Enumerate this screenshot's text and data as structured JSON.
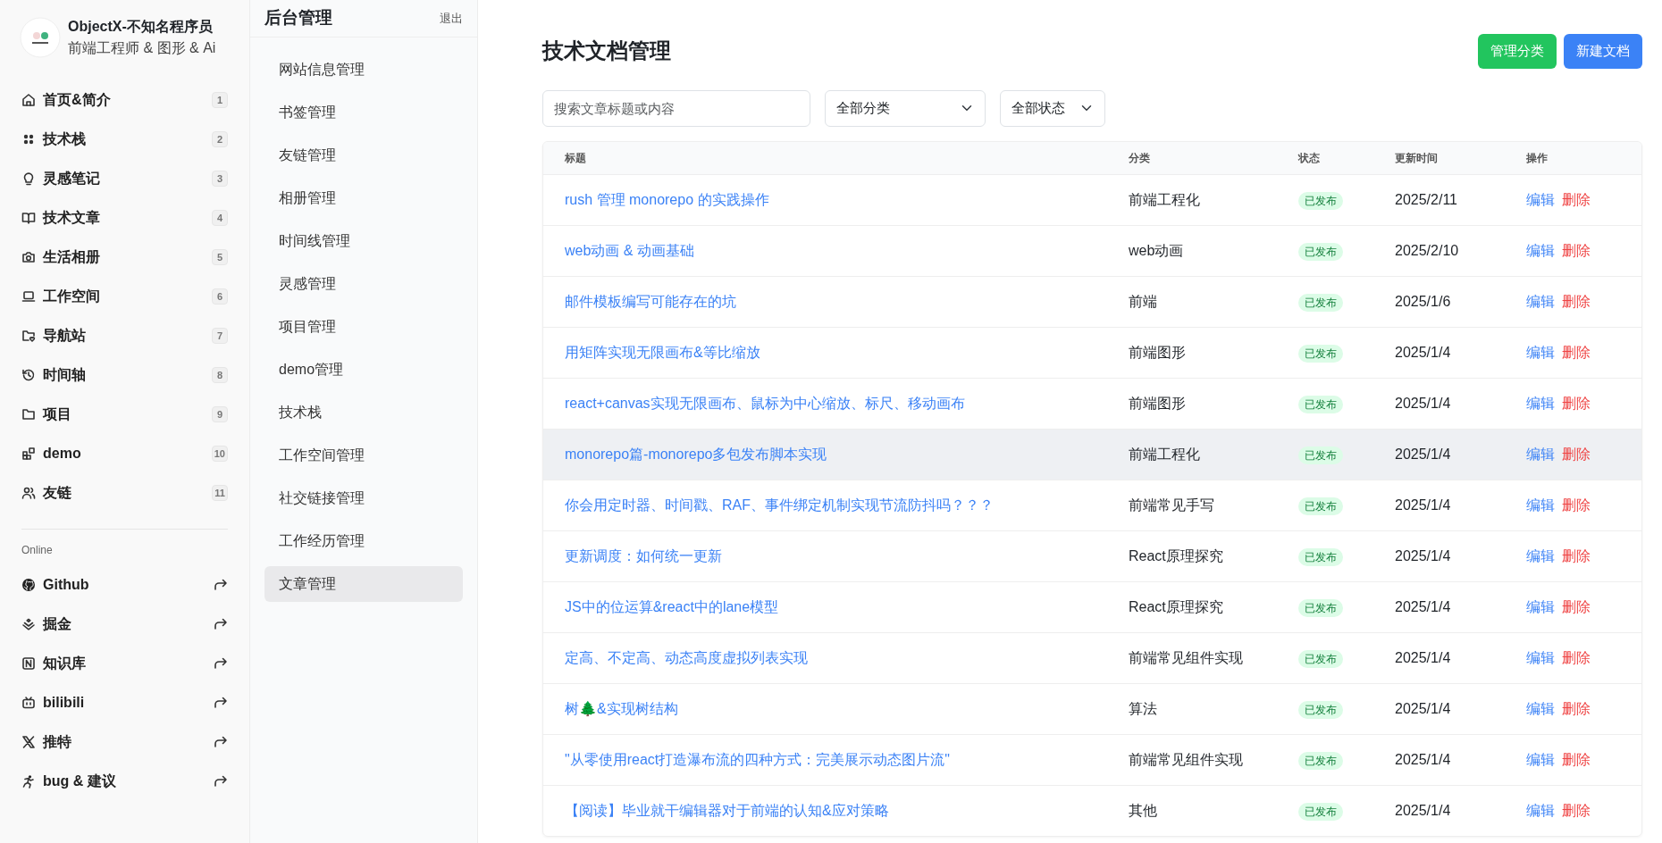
{
  "profile": {
    "name": "ObjectX-不知名程序员",
    "subtitle": "前端工程师 & 图形 & Ai"
  },
  "nav": [
    {
      "label": "首页&简介",
      "count": "1"
    },
    {
      "label": "技术栈",
      "count": "2"
    },
    {
      "label": "灵感笔记",
      "count": "3"
    },
    {
      "label": "技术文章",
      "count": "4"
    },
    {
      "label": "生活相册",
      "count": "5"
    },
    {
      "label": "工作空间",
      "count": "6"
    },
    {
      "label": "导航站",
      "count": "7"
    },
    {
      "label": "时间轴",
      "count": "8"
    },
    {
      "label": "项目",
      "count": "9"
    },
    {
      "label": "demo",
      "count": "10"
    },
    {
      "label": "友链",
      "count": "11"
    }
  ],
  "online": {
    "heading": "Online",
    "links": [
      {
        "label": "Github"
      },
      {
        "label": "掘金"
      },
      {
        "label": "知识库"
      },
      {
        "label": "bilibili"
      },
      {
        "label": "推特"
      },
      {
        "label": "bug & 建议"
      }
    ]
  },
  "admin": {
    "title": "后台管理",
    "logout": "退出",
    "items": [
      {
        "label": "网站信息管理",
        "selected": false
      },
      {
        "label": "书签管理",
        "selected": false
      },
      {
        "label": "友链管理",
        "selected": false
      },
      {
        "label": "相册管理",
        "selected": false
      },
      {
        "label": "时间线管理",
        "selected": false
      },
      {
        "label": "灵感管理",
        "selected": false
      },
      {
        "label": "项目管理",
        "selected": false
      },
      {
        "label": "demo管理",
        "selected": false
      },
      {
        "label": "技术栈",
        "selected": false
      },
      {
        "label": "工作空间管理",
        "selected": false
      },
      {
        "label": "社交链接管理",
        "selected": false
      },
      {
        "label": "工作经历管理",
        "selected": false
      },
      {
        "label": "文章管理",
        "selected": true
      }
    ]
  },
  "page": {
    "title": "技术文档管理",
    "buttons": [
      {
        "label": "管理分类",
        "kind": "success"
      },
      {
        "label": "新建文档",
        "kind": "primary"
      }
    ],
    "search": {
      "placeholder": "搜索文章标题或内容"
    },
    "category_filter": "全部分类",
    "status_filter": "全部状态"
  },
  "table": {
    "columns": [
      "标题",
      "分类",
      "状态",
      "更新时间",
      "操作"
    ],
    "rows": [
      {
        "title": "rush 管理 monorepo 的实践操作",
        "category": "前端工程化",
        "status": "已发布",
        "updated": "2025/2/11",
        "edit": "编辑",
        "delete": "删除",
        "highlighted": false
      },
      {
        "title": "web动画 & 动画基础",
        "category": "web动画",
        "status": "已发布",
        "updated": "2025/2/10",
        "edit": "编辑",
        "delete": "删除",
        "highlighted": false
      },
      {
        "title": "邮件模板编写可能存在的坑",
        "category": "前端",
        "status": "已发布",
        "updated": "2025/1/6",
        "edit": "编辑",
        "delete": "删除",
        "highlighted": false
      },
      {
        "title": "用矩阵实现无限画布&等比缩放",
        "category": "前端图形",
        "status": "已发布",
        "updated": "2025/1/4",
        "edit": "编辑",
        "delete": "删除",
        "highlighted": false
      },
      {
        "title": "react+canvas实现无限画布、鼠标为中心缩放、标尺、移动画布",
        "category": "前端图形",
        "status": "已发布",
        "updated": "2025/1/4",
        "edit": "编辑",
        "delete": "删除",
        "highlighted": false
      },
      {
        "title": "monorepo篇-monorepo多包发布脚本实现",
        "category": "前端工程化",
        "status": "已发布",
        "updated": "2025/1/4",
        "edit": "编辑",
        "delete": "删除",
        "highlighted": true
      },
      {
        "title": "你会用定时器、时间戳、RAF、事件绑定机制实现节流防抖吗？？？",
        "category": "前端常见手写",
        "status": "已发布",
        "updated": "2025/1/4",
        "edit": "编辑",
        "delete": "删除",
        "highlighted": false
      },
      {
        "title": "更新调度：如何统一更新",
        "category": "React原理探究",
        "status": "已发布",
        "updated": "2025/1/4",
        "edit": "编辑",
        "delete": "删除",
        "highlighted": false
      },
      {
        "title": "JS中的位运算&react中的lane模型",
        "category": "React原理探究",
        "status": "已发布",
        "updated": "2025/1/4",
        "edit": "编辑",
        "delete": "删除",
        "highlighted": false
      },
      {
        "title": "定高、不定高、动态高度虚拟列表实现",
        "category": "前端常见组件实现",
        "status": "已发布",
        "updated": "2025/1/4",
        "edit": "编辑",
        "delete": "删除",
        "highlighted": false
      },
      {
        "title": "树🌲&实现树结构",
        "category": "算法",
        "status": "已发布",
        "updated": "2025/1/4",
        "edit": "编辑",
        "delete": "删除",
        "highlighted": false
      },
      {
        "title": "\"从零使用react打造瀑布流的四种方式：完美展示动态图片流\"",
        "category": "前端常见组件实现",
        "status": "已发布",
        "updated": "2025/1/4",
        "edit": "编辑",
        "delete": "删除",
        "highlighted": false
      },
      {
        "title": "【阅读】毕业就干编辑器对于前端的认知&应对策略",
        "category": "其他",
        "status": "已发布",
        "updated": "2025/1/4",
        "edit": "编辑",
        "delete": "删除",
        "highlighted": false
      }
    ]
  }
}
